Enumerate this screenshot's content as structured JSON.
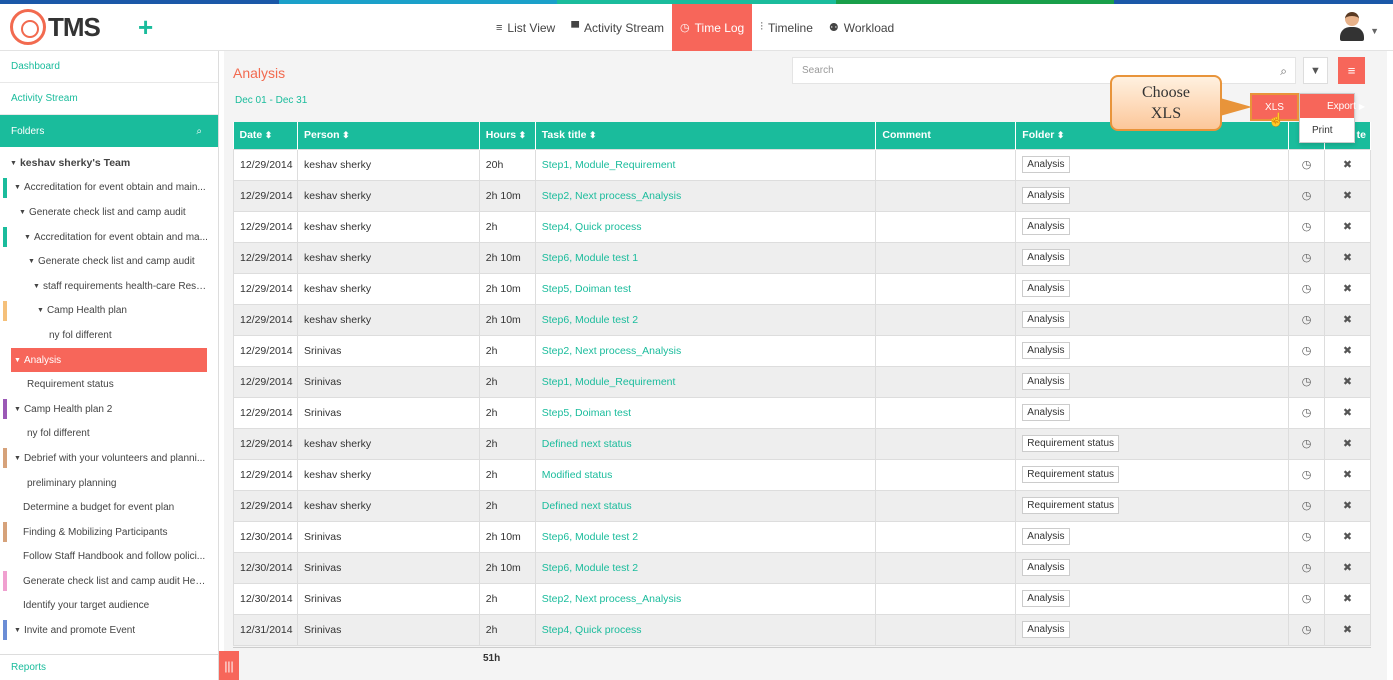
{
  "app": {
    "logo_text": "TMS",
    "plus_icon": "+"
  },
  "colors": {
    "accent": "#1abc9c",
    "active": "#f7665a",
    "title": "#f26a4f",
    "callout_border": "#e8943a"
  },
  "topstripe": [
    "#1b58a8",
    "#1ba0c9",
    "#1abc9c",
    "#199f4a",
    "#1b58a8"
  ],
  "nav": [
    {
      "label": "List View",
      "icon": "≡",
      "active": false
    },
    {
      "label": "Activity Stream",
      "icon": "▀",
      "active": false
    },
    {
      "label": "Time Log",
      "icon": "◷",
      "active": true
    },
    {
      "label": "Timeline",
      "icon": "⫶",
      "active": false
    },
    {
      "label": "Workload",
      "icon": "⚉",
      "active": false
    }
  ],
  "sidebar": {
    "dashboard": "Dashboard",
    "activity_stream": "Activity Stream",
    "folders": "Folders",
    "reports": "Reports",
    "tree": [
      {
        "label": "keshav sherky's Team",
        "indent": 10,
        "tri": "▼",
        "bold": true,
        "bar": ""
      },
      {
        "label": "Accreditation for event obtain and main...",
        "indent": 14,
        "tri": "▼",
        "bar": "#1abc9c"
      },
      {
        "label": "Generate check list and camp audit",
        "indent": 19,
        "tri": "▼",
        "bar": ""
      },
      {
        "label": "Accreditation for event obtain and ma...",
        "indent": 24,
        "tri": "▼",
        "bar": "#1abc9c"
      },
      {
        "label": "Generate check list and camp audit",
        "indent": 28,
        "tri": "▼",
        "bar": ""
      },
      {
        "label": "staff requirements health-care Resp...",
        "indent": 33,
        "tri": "▼",
        "bar": ""
      },
      {
        "label": "Camp Health plan",
        "indent": 37,
        "tri": "▼",
        "bar": "#f5c07a"
      },
      {
        "label": "ny fol different",
        "indent": 49,
        "tri": "",
        "bar": ""
      },
      {
        "label": "Analysis",
        "indent": 14,
        "tri": "▼",
        "bar": "",
        "active": true
      },
      {
        "label": "Requirement status",
        "indent": 27,
        "tri": "",
        "bar": ""
      },
      {
        "label": "Camp Health plan 2",
        "indent": 14,
        "tri": "▼",
        "bar": "#9b59b6"
      },
      {
        "label": "ny fol different",
        "indent": 27,
        "tri": "",
        "bar": ""
      },
      {
        "label": "Debrief with your volunteers and planni...",
        "indent": 14,
        "tri": "▼",
        "bar": "#d6a27a"
      },
      {
        "label": "preliminary planning",
        "indent": 27,
        "tri": "",
        "bar": ""
      },
      {
        "label": "Determine a budget for event plan",
        "indent": 23,
        "tri": "",
        "bar": ""
      },
      {
        "label": "Finding & Mobilizing Participants",
        "indent": 23,
        "tri": "",
        "bar": "#d6a27a"
      },
      {
        "label": "Follow Staff Handbook and follow polici...",
        "indent": 23,
        "tri": "",
        "bar": ""
      },
      {
        "label": "Generate check list and camp audit Heal...",
        "indent": 23,
        "tri": "",
        "bar": "#f0a0d0"
      },
      {
        "label": "Identify your target audience",
        "indent": 23,
        "tri": "",
        "bar": ""
      },
      {
        "label": "Invite and promote Event",
        "indent": 14,
        "tri": "▼",
        "bar": "#6b8dd6"
      }
    ]
  },
  "main": {
    "title": "Analysis",
    "range_start": "Dec 01",
    "range_sep": "-",
    "range_end": "Dec 31",
    "search_placeholder": "Search",
    "menu_icon": "≡",
    "columns": [
      "Date",
      "Person",
      "Hours",
      "Task title",
      "Comment",
      "Folder",
      "",
      "te"
    ],
    "rows": [
      {
        "date": "12/29/2014",
        "person": "keshav sherky",
        "hours": "20h",
        "task": "Step1, Module_Requirement",
        "comment": "",
        "folder": "Analysis"
      },
      {
        "date": "12/29/2014",
        "person": "keshav sherky",
        "hours": "2h 10m",
        "task": "Step2, Next process_Analysis",
        "comment": "",
        "folder": "Analysis"
      },
      {
        "date": "12/29/2014",
        "person": "keshav sherky",
        "hours": "2h",
        "task": "Step4, Quick process",
        "comment": "",
        "folder": "Analysis"
      },
      {
        "date": "12/29/2014",
        "person": "keshav sherky",
        "hours": "2h 10m",
        "task": "Step6, Module test 1",
        "comment": "",
        "folder": "Analysis"
      },
      {
        "date": "12/29/2014",
        "person": "keshav sherky",
        "hours": "2h 10m",
        "task": "Step5, Doiman test",
        "comment": "",
        "folder": "Analysis"
      },
      {
        "date": "12/29/2014",
        "person": "keshav sherky",
        "hours": "2h 10m",
        "task": "Step6, Module test 2",
        "comment": "",
        "folder": "Analysis"
      },
      {
        "date": "12/29/2014",
        "person": "Srinivas",
        "hours": "2h",
        "task": "Step2, Next process_Analysis",
        "comment": "",
        "folder": "Analysis"
      },
      {
        "date": "12/29/2014",
        "person": "Srinivas",
        "hours": "2h",
        "task": "Step1, Module_Requirement",
        "comment": "",
        "folder": "Analysis"
      },
      {
        "date": "12/29/2014",
        "person": "Srinivas",
        "hours": "2h",
        "task": "Step5, Doiman test",
        "comment": "",
        "folder": "Analysis"
      },
      {
        "date": "12/29/2014",
        "person": "keshav sherky",
        "hours": "2h",
        "task": "Defined next status",
        "comment": "",
        "folder": "Requirement status"
      },
      {
        "date": "12/29/2014",
        "person": "keshav sherky",
        "hours": "2h",
        "task": "Modified status",
        "comment": "",
        "folder": "Requirement status"
      },
      {
        "date": "12/29/2014",
        "person": "keshav sherky",
        "hours": "2h",
        "task": "Defined next status",
        "comment": "",
        "folder": "Requirement status"
      },
      {
        "date": "12/30/2014",
        "person": "Srinivas",
        "hours": "2h 10m",
        "task": "Step6, Module test 2",
        "comment": "",
        "folder": "Analysis"
      },
      {
        "date": "12/30/2014",
        "person": "Srinivas",
        "hours": "2h 10m",
        "task": "Step6, Module test 2",
        "comment": "",
        "folder": "Analysis"
      },
      {
        "date": "12/30/2014",
        "person": "Srinivas",
        "hours": "2h",
        "task": "Step2, Next process_Analysis",
        "comment": "",
        "folder": "Analysis"
      },
      {
        "date": "12/31/2014",
        "person": "Srinivas",
        "hours": "2h",
        "task": "Step4, Quick process",
        "comment": "",
        "folder": "Analysis"
      }
    ],
    "total_hours": "51h"
  },
  "menu": {
    "xls": "XLS",
    "export": "Export",
    "print": "Print"
  },
  "callout": {
    "line1": "Choose",
    "line2": "XLS"
  }
}
